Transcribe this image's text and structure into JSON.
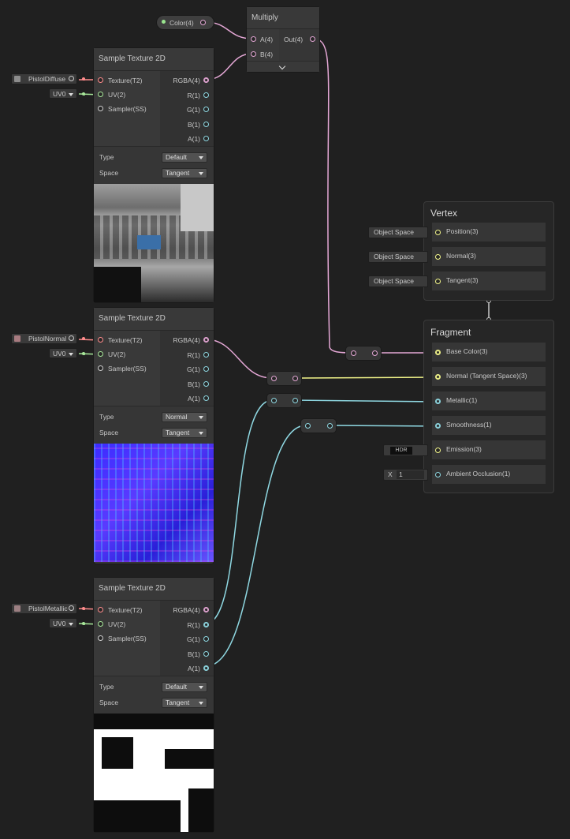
{
  "multiply": {
    "title": "Multiply",
    "in_a": "A(4)",
    "in_b": "B(4)",
    "out": "Out(4)"
  },
  "color_prop": {
    "label": "Color(4)"
  },
  "sample_nodes": [
    {
      "title": "Sample Texture 2D",
      "texture_input": "PistolDiffuse",
      "uv_input": "UV0",
      "inputs": [
        "Texture(T2)",
        "UV(2)",
        "Sampler(SS)"
      ],
      "outputs": [
        "RGBA(4)",
        "R(1)",
        "G(1)",
        "B(1)",
        "A(1)"
      ],
      "type_label": "Type",
      "type_value": "Default",
      "space_label": "Space",
      "space_value": "Tangent"
    },
    {
      "title": "Sample Texture 2D",
      "texture_input": "PistolNormal",
      "uv_input": "UV0",
      "inputs": [
        "Texture(T2)",
        "UV(2)",
        "Sampler(SS)"
      ],
      "outputs": [
        "RGBA(4)",
        "R(1)",
        "G(1)",
        "B(1)",
        "A(1)"
      ],
      "type_label": "Type",
      "type_value": "Normal",
      "space_label": "Space",
      "space_value": "Tangent"
    },
    {
      "title": "Sample Texture 2D",
      "texture_input": "PistolMetallic",
      "uv_input": "UV0",
      "inputs": [
        "Texture(T2)",
        "UV(2)",
        "Sampler(SS)"
      ],
      "outputs": [
        "RGBA(4)",
        "R(1)",
        "G(1)",
        "B(1)",
        "A(1)"
      ],
      "type_label": "Type",
      "type_value": "Default",
      "space_label": "Space",
      "space_value": "Tangent"
    }
  ],
  "vertex": {
    "title": "Vertex",
    "blocks": [
      {
        "input": "Object Space",
        "label": "Position(3)"
      },
      {
        "input": "Object Space",
        "label": "Normal(3)"
      },
      {
        "input": "Object Space",
        "label": "Tangent(3)"
      }
    ]
  },
  "fragment": {
    "title": "Fragment",
    "blocks": [
      {
        "label": "Base Color(3)"
      },
      {
        "label": "Normal (Tangent Space)(3)"
      },
      {
        "label": "Metallic(1)"
      },
      {
        "label": "Smoothness(1)"
      },
      {
        "label": "Emission(3)",
        "input": "HDR"
      },
      {
        "label": "Ambient Occlusion(1)",
        "input_axis": "X",
        "input_value": "1"
      }
    ]
  },
  "colors": {
    "background": "#202020",
    "vec4": "#e4a7d5",
    "vec3": "#f2f58a",
    "vec1": "#8fd8e2",
    "vec2": "#a8e89a",
    "texture": "#ff8c8c"
  }
}
